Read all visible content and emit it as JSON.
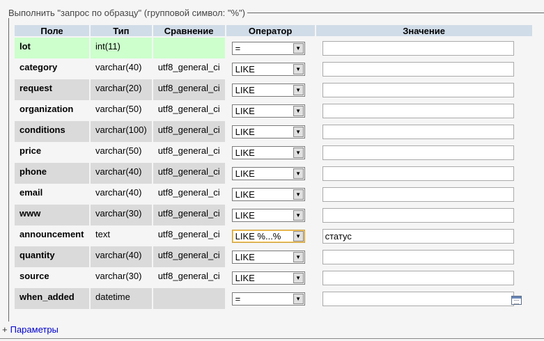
{
  "legend": "Выполнить \"запрос по образцу\" (групповой символ: \"%\")",
  "headers": [
    "Поле",
    "Тип",
    "Сравнение",
    "Оператор",
    "Значение"
  ],
  "rows": [
    {
      "field": "lot",
      "type": "int(11)",
      "collation": "",
      "operator": "=",
      "value": "",
      "highlight": true
    },
    {
      "field": "category",
      "type": "varchar(40)",
      "collation": "utf8_general_ci",
      "operator": "LIKE",
      "value": ""
    },
    {
      "field": "request",
      "type": "varchar(20)",
      "collation": "utf8_general_ci",
      "operator": "LIKE",
      "value": ""
    },
    {
      "field": "organization",
      "type": "varchar(50)",
      "collation": "utf8_general_ci",
      "operator": "LIKE",
      "value": ""
    },
    {
      "field": "conditions",
      "type": "varchar(100)",
      "collation": "utf8_general_ci",
      "operator": "LIKE",
      "value": ""
    },
    {
      "field": "price",
      "type": "varchar(50)",
      "collation": "utf8_general_ci",
      "operator": "LIKE",
      "value": ""
    },
    {
      "field": "phone",
      "type": "varchar(40)",
      "collation": "utf8_general_ci",
      "operator": "LIKE",
      "value": ""
    },
    {
      "field": "email",
      "type": "varchar(40)",
      "collation": "utf8_general_ci",
      "operator": "LIKE",
      "value": ""
    },
    {
      "field": "www",
      "type": "varchar(30)",
      "collation": "utf8_general_ci",
      "operator": "LIKE",
      "value": ""
    },
    {
      "field": "announcement",
      "type": "text",
      "collation": "utf8_general_ci",
      "operator": "LIKE %...%",
      "value": "статус",
      "active": true
    },
    {
      "field": "quantity",
      "type": "varchar(40)",
      "collation": "utf8_general_ci",
      "operator": "LIKE",
      "value": ""
    },
    {
      "field": "source",
      "type": "varchar(30)",
      "collation": "utf8_general_ci",
      "operator": "LIKE",
      "value": ""
    },
    {
      "field": "when_added",
      "type": "datetime",
      "collation": "",
      "operator": "=",
      "value": ""
    }
  ],
  "params_toggle": "+",
  "params_link": "Параметры",
  "icons": {
    "select_arrow": "dropdown-arrow-icon",
    "calendar": "calendar-icon"
  },
  "colors": {
    "header_bg": "#d0dce8",
    "highlight_row": "#ccffcc",
    "odd_row": "#dadada",
    "link": "#0000cc"
  }
}
